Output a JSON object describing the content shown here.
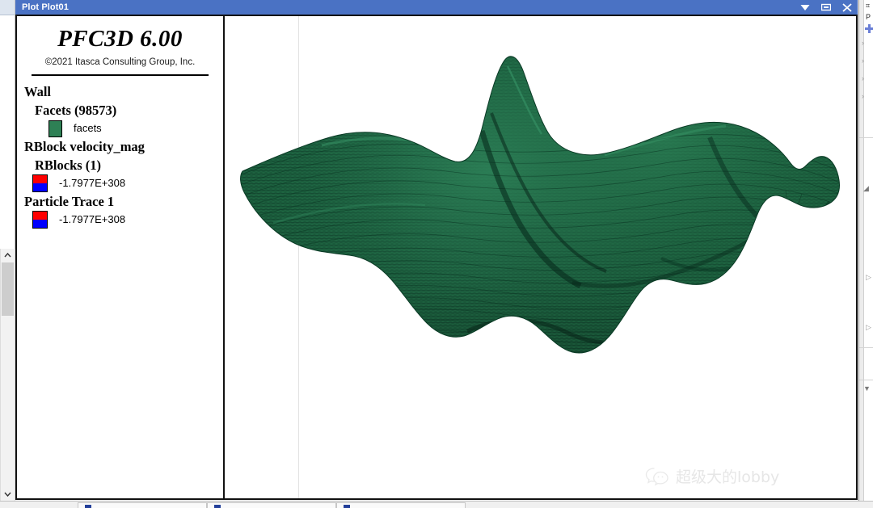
{
  "window": {
    "title": "Plot Plot01",
    "titlebar_color": "#4a72c4",
    "controls": [
      {
        "name": "menu-dropdown",
        "glyph": "▼"
      },
      {
        "name": "restore",
        "glyph": "▭"
      },
      {
        "name": "close",
        "glyph": "✕"
      }
    ]
  },
  "legend": {
    "brand": "PFC3D 6.00",
    "copyright": "©2021 Itasca Consulting Group, Inc.",
    "groups": [
      {
        "heading": "Wall",
        "sub_heading": "Facets (98573)",
        "items": [
          {
            "label": "facets",
            "swatch_type": "solid",
            "color": "#2e8055"
          }
        ]
      },
      {
        "heading": "RBlock velocity_mag",
        "sub_heading": "RBlocks (1)",
        "items": [
          {
            "label": "-1.7977E+308",
            "swatch_type": "split",
            "color_top": "#ff0000",
            "color_bottom": "#0000ff"
          }
        ]
      },
      {
        "heading": "Particle Trace 1",
        "sub_heading": "",
        "items": [
          {
            "label": "-1.7977E+308",
            "swatch_type": "split",
            "color_top": "#ff0000",
            "color_bottom": "#0000ff"
          }
        ]
      }
    ]
  },
  "viewport": {
    "surface_color": "#1f6b45",
    "surface_highlight": "#2f8a5c",
    "surface_shadow": "#0b3a26",
    "background": "#ffffff"
  },
  "watermark": {
    "text": "超级大的lobby",
    "icon": "wechat-icon",
    "color": "#d2d2d2"
  },
  "right_panel": {
    "rows": [
      {
        "glyph": "⌗",
        "label": ""
      },
      {
        "glyph": "P",
        "label": ""
      },
      {
        "glyph": "",
        "label": ""
      },
      {
        "glyph": "›",
        "label": ""
      },
      {
        "glyph": "›",
        "label": ""
      },
      {
        "glyph": "›",
        "label": ""
      },
      {
        "glyph": "›",
        "label": ""
      },
      {
        "glyph": "◢",
        "label": ""
      },
      {
        "glyph": "▷",
        "label": ""
      },
      {
        "glyph": "▷",
        "label": ""
      },
      {
        "glyph": "▼",
        "label": ""
      }
    ]
  },
  "bottom_tabs": [
    {
      "name": "tab-1"
    },
    {
      "name": "tab-2"
    },
    {
      "name": "tab-3"
    }
  ],
  "scrollbar": {
    "up_glyph": "⌃",
    "down_glyph": "⌄",
    "thumb_color": "#cdcdcd"
  }
}
